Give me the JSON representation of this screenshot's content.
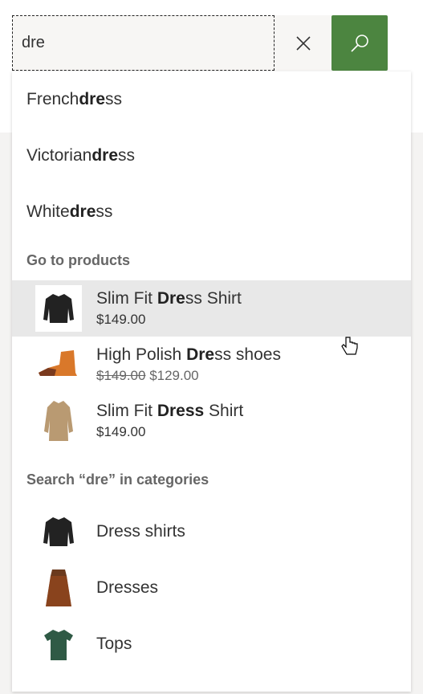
{
  "search": {
    "value": "dre",
    "clear_icon": "close-icon",
    "submit_icon": "search-icon",
    "accent": "#4c8540"
  },
  "suggestions": [
    {
      "pre": "French ",
      "match": "dre",
      "post": "ss"
    },
    {
      "pre": "Victorian ",
      "match": "dre",
      "post": "ss"
    },
    {
      "pre": "White ",
      "match": "dre",
      "post": "ss"
    }
  ],
  "products_heading": "Go to products",
  "products": [
    {
      "pre": "Slim Fit ",
      "match": "Dre",
      "post": "ss Shirt",
      "price": "$149.00",
      "icon": "shirt-icon"
    },
    {
      "pre": "High Polish ",
      "match": "Dre",
      "post": "ss shoes",
      "old_price": "$149.00",
      "price": "$129.00",
      "icon": "shoe-icon"
    },
    {
      "pre": "Slim Fit ",
      "match": "Dress",
      "post": " Shirt",
      "price": "$149.00",
      "icon": "coat-icon"
    }
  ],
  "categories_heading": "Search “dre” in categories",
  "categories": [
    {
      "label": "Dress shirts",
      "icon": "shirt-icon"
    },
    {
      "label": "Dresses",
      "icon": "dress-icon"
    },
    {
      "label": "Tops",
      "icon": "tshirt-icon"
    }
  ]
}
